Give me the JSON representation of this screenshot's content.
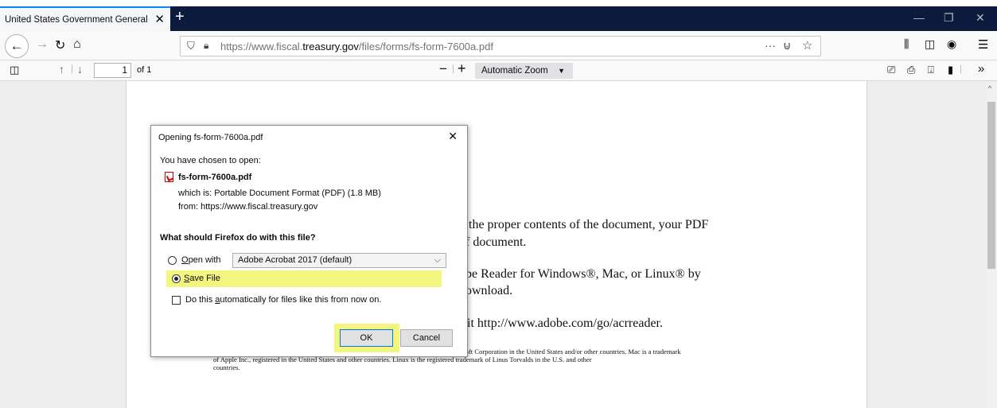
{
  "browser": {
    "tab_title": "United States Government General",
    "url_domain_prefix": "https://www.fiscal.",
    "url_domain": "treasury.gov",
    "url_path": "/files/forms/fs-form-7600a.pdf"
  },
  "pdf_toolbar": {
    "page_value": "1",
    "page_total": "of 1",
    "zoom_label": "Automatic Zoom"
  },
  "document": {
    "line1": "y the proper contents of the document, your PDF",
    "line2": "of document.",
    "line3": "obe Reader for Windows®, Mac, or Linux® by",
    "line4": "download.",
    "line5": "it  http://www.adobe.com/go/acrreader.",
    "footnote1": "osoft Corporation in the United States and/or other countries. Mac is a trademark",
    "footnote2": "of Apple Inc., registered in the United States and other countries. Linux is the registered trademark of Linus Torvalds in the U.S. and other",
    "footnote3": "countries."
  },
  "dialog": {
    "title": "Opening fs-form-7600a.pdf",
    "chosen_label": "You have chosen to open:",
    "file_name": "fs-form-7600a.pdf",
    "which_is": "which is:  Portable Document Format (PDF) (1.8 MB)",
    "from": "from:  https://www.fiscal.treasury.gov",
    "question": "What should Firefox do with this file?",
    "open_with_label_first": "O",
    "open_with_label_rest": "pen with",
    "app_option": "Adobe Acrobat 2017 (default)",
    "save_label_first": "S",
    "save_label_rest": "ave File",
    "auto_label_prefix": "Do this ",
    "auto_label_underlined": "a",
    "auto_label_rest": "utomatically for files like this from now on.",
    "ok_label": "OK",
    "cancel_label": "Cancel",
    "selected_option": "Save File",
    "highlight_color": "#f2f57e"
  }
}
